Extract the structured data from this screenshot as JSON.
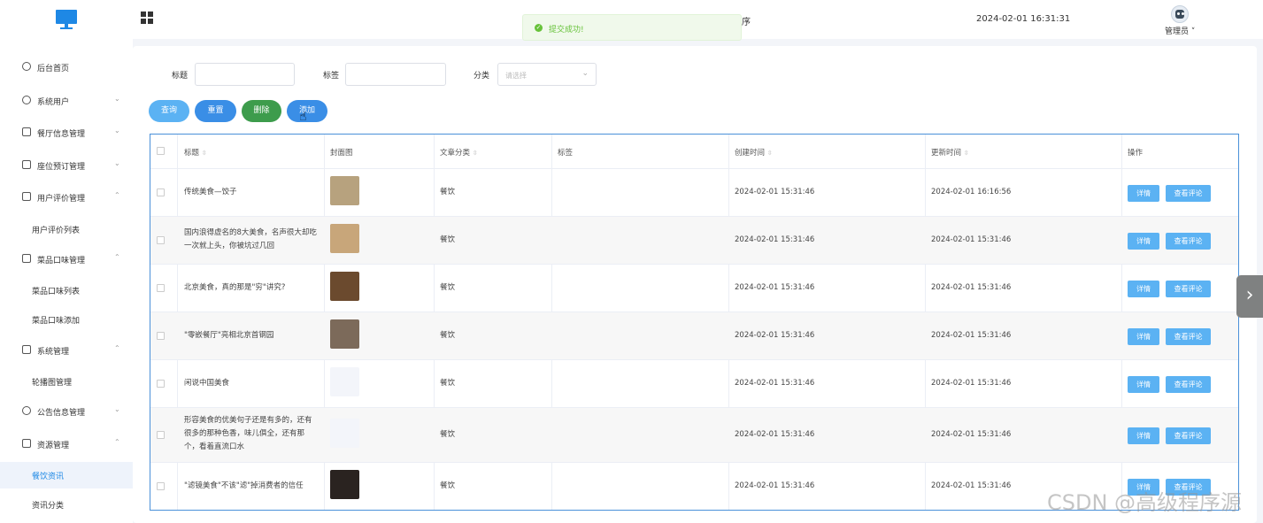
{
  "header": {
    "title_fragment": "序",
    "datetime": "2024-02-01 16:31:31",
    "user_name": "管理员 ˅"
  },
  "toast": {
    "message": "提交成功!"
  },
  "sidebar": {
    "items": [
      {
        "label": "后台首页",
        "icon": "clock-icon",
        "arrow": ""
      },
      {
        "label": "系统用户",
        "icon": "user-icon",
        "arrow": "⌄"
      },
      {
        "label": "餐厅信息管理",
        "icon": "list-icon",
        "arrow": "⌄"
      },
      {
        "label": "座位预订管理",
        "icon": "list-icon",
        "arrow": "⌄"
      },
      {
        "label": "用户评价管理",
        "icon": "list-icon",
        "arrow": "⌃"
      },
      {
        "label": "用户评价列表",
        "sub": true
      },
      {
        "label": "菜品口味管理",
        "icon": "list-icon",
        "arrow": "⌃"
      },
      {
        "label": "菜品口味列表",
        "sub": true
      },
      {
        "label": "菜品口味添加",
        "sub": true
      },
      {
        "label": "系统管理",
        "icon": "folder-icon",
        "arrow": "⌃"
      },
      {
        "label": "轮播图管理",
        "sub": true
      },
      {
        "label": "公告信息管理",
        "icon": "sun-icon",
        "arrow": "⌄"
      },
      {
        "label": "资源管理",
        "icon": "printer-icon",
        "arrow": "⌃"
      },
      {
        "label": "餐饮资讯",
        "sub": true,
        "active": true
      },
      {
        "label": "资讯分类",
        "sub": true
      }
    ]
  },
  "filters": {
    "title_label": "标题",
    "tag_label": "标签",
    "category_label": "分类",
    "category_placeholder": "请选择"
  },
  "buttons": {
    "query": "查询",
    "reset": "重置",
    "delete": "删除",
    "add": "添加"
  },
  "table": {
    "headers": {
      "title": "标题",
      "cover": "封面图",
      "category": "文章分类",
      "tags": "标签",
      "created": "创建时间",
      "updated": "更新时间",
      "actions": "操作"
    },
    "sort_icon": "⇳",
    "detail_label": "详情",
    "comment_label": "查看评论",
    "rows": [
      {
        "title": "传统美食—饺子",
        "category": "餐饮",
        "created": "2024-02-01 15:31:46",
        "updated": "2024-02-01 16:16:56",
        "thumb": "#b7a27e"
      },
      {
        "title": "国内浪得虚名的8大美食，名声很大却吃一次就上头，你被坑过几回",
        "category": "餐饮",
        "created": "2024-02-01 15:31:46",
        "updated": "2024-02-01 15:31:46",
        "thumb": "#c8a67a"
      },
      {
        "title": "北京美食，真的那是\"穷\"讲究?",
        "category": "餐饮",
        "created": "2024-02-01 15:31:46",
        "updated": "2024-02-01 15:31:46",
        "thumb": "#6b4a2e"
      },
      {
        "title": "\"零嵌餐厅\"亮相北京首钢园",
        "category": "餐饮",
        "created": "2024-02-01 15:31:46",
        "updated": "2024-02-01 15:31:46",
        "thumb": "#7c6a5a"
      },
      {
        "title": "闲说中国美食",
        "category": "餐饮",
        "created": "2024-02-01 15:31:46",
        "updated": "2024-02-01 15:31:46",
        "thumb": "#f3f5fa"
      },
      {
        "title": "形容美食的优美句子还是有多的，还有很多的那种色香，味儿俱全，还有那个，看着直流口水",
        "category": "餐饮",
        "created": "2024-02-01 15:31:46",
        "updated": "2024-02-01 15:31:46",
        "thumb": "#f3f5fa"
      },
      {
        "title": "\"滤镜美食\"不该\"滤\"掉消费者的信任",
        "category": "餐饮",
        "created": "2024-02-01 15:31:46",
        "updated": "2024-02-01 15:31:46",
        "thumb": "#2a2320"
      }
    ]
  },
  "watermark": "CSDN @高级程序源"
}
